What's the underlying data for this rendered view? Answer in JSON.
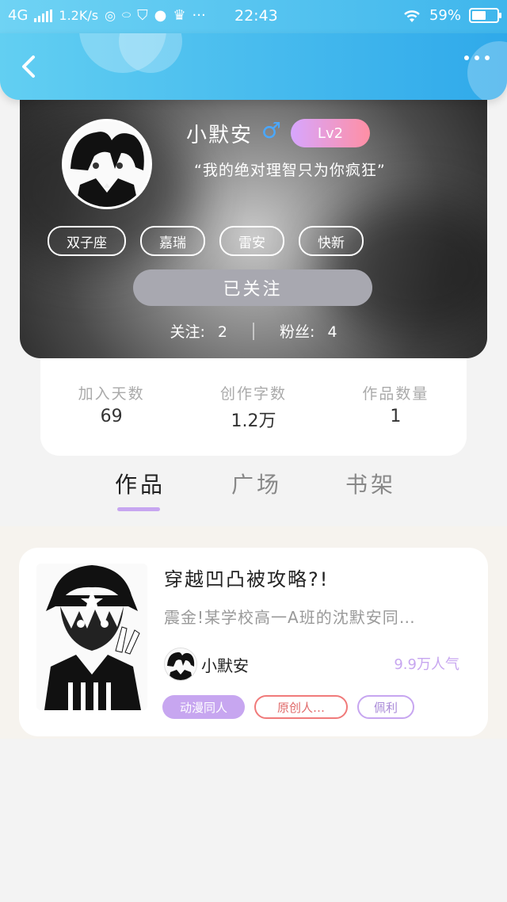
{
  "status_bar": {
    "network": "4G",
    "speed": "1.2K/s",
    "time": "22:43",
    "battery_percent": "59%",
    "battery_level": 0.59,
    "dots": "···",
    "app_icons": [
      "chat-icon",
      "weibo-icon",
      "shield-icon",
      "mail-icon",
      "crown-icon"
    ]
  },
  "nav": {
    "back_icon": "chevron-left-icon",
    "more_icon": "more-dots-icon",
    "accent": "#3fb6ec"
  },
  "profile": {
    "username": "小默安",
    "gender_symbol": "♂",
    "level": "Lv2",
    "signature": "“我的绝对理智只为你疯狂”",
    "tags": [
      "双子座",
      "嘉瑞",
      "雷安",
      "快新"
    ],
    "follow_button": "已关注",
    "following_label": "关注:",
    "following_count": "2",
    "fans_label": "粉丝:",
    "fans_count": "4"
  },
  "stats": [
    {
      "label": "加入天数",
      "value": "69"
    },
    {
      "label": "创作字数",
      "value": "1.2万"
    },
    {
      "label": "作品数量",
      "value": "1"
    }
  ],
  "tabs": [
    {
      "label": "作品",
      "active": true
    },
    {
      "label": "广场",
      "active": false
    },
    {
      "label": "书架",
      "active": false
    }
  ],
  "works": [
    {
      "title": "穿越凹凸被攻略?!",
      "description": "震金!某学校高一A班的沈默安同…",
      "author": "小默安",
      "popularity": "9.9万人气",
      "tags": [
        "动漫同人",
        "原创人…",
        "佩利"
      ]
    }
  ],
  "colors": {
    "level_gradient_start": "#d7a6ff",
    "level_gradient_end": "#ff8fa4",
    "tab_indicator": "#c7a6f0",
    "gender": "#4aa8ff"
  }
}
